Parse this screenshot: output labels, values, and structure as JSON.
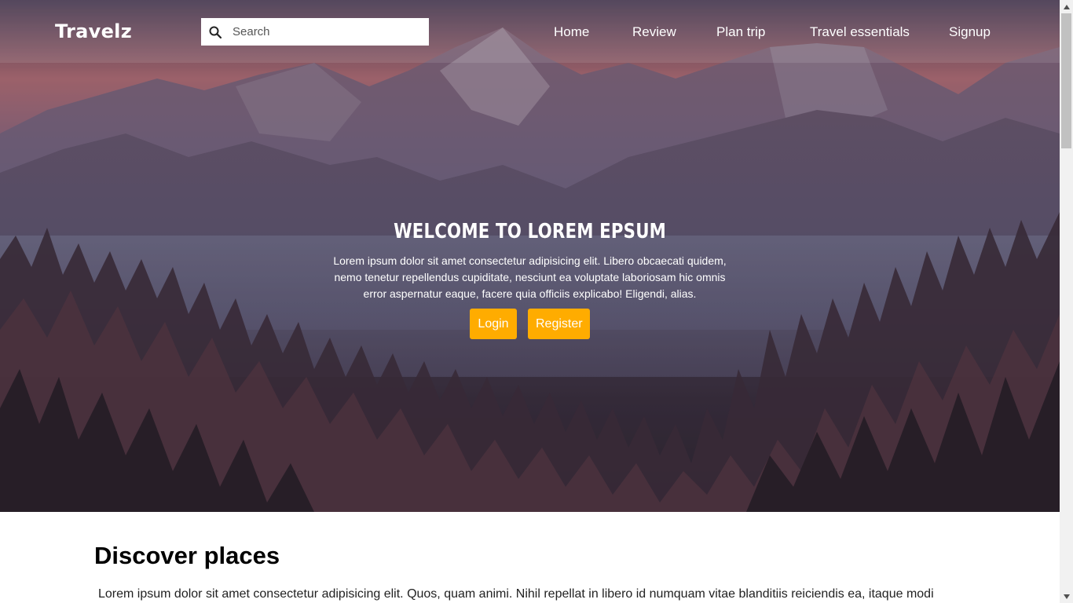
{
  "brand": {
    "logo_text": "Travelz"
  },
  "search": {
    "placeholder": "Search",
    "value": "",
    "icon": "search-icon"
  },
  "nav": {
    "items": [
      {
        "label": "Home"
      },
      {
        "label": "Review"
      },
      {
        "label": "Plan trip"
      },
      {
        "label": "Travel essentials"
      },
      {
        "label": "Signup"
      }
    ]
  },
  "hero": {
    "title": "Welcome to Lorem Epsum",
    "text": "Lorem ipsum dolor sit amet consectetur adipisicing elit. Libero obcaecati quidem, nemo tenetur repellendus cupiditate, nesciunt ea voluptate laboriosam hic omnis error aspernatur eaque, facere quia officiis explicabo! Eligendi, alias.",
    "login_label": "Login",
    "register_label": "Register",
    "button_color": "#ffac00"
  },
  "discover": {
    "title": "Discover places",
    "text": "Lorem ipsum dolor sit amet consectetur adipisicing elit. Quos, quam animi. Nihil repellat in libero id numquam vitae blanditiis reiciendis ea, itaque modi"
  }
}
